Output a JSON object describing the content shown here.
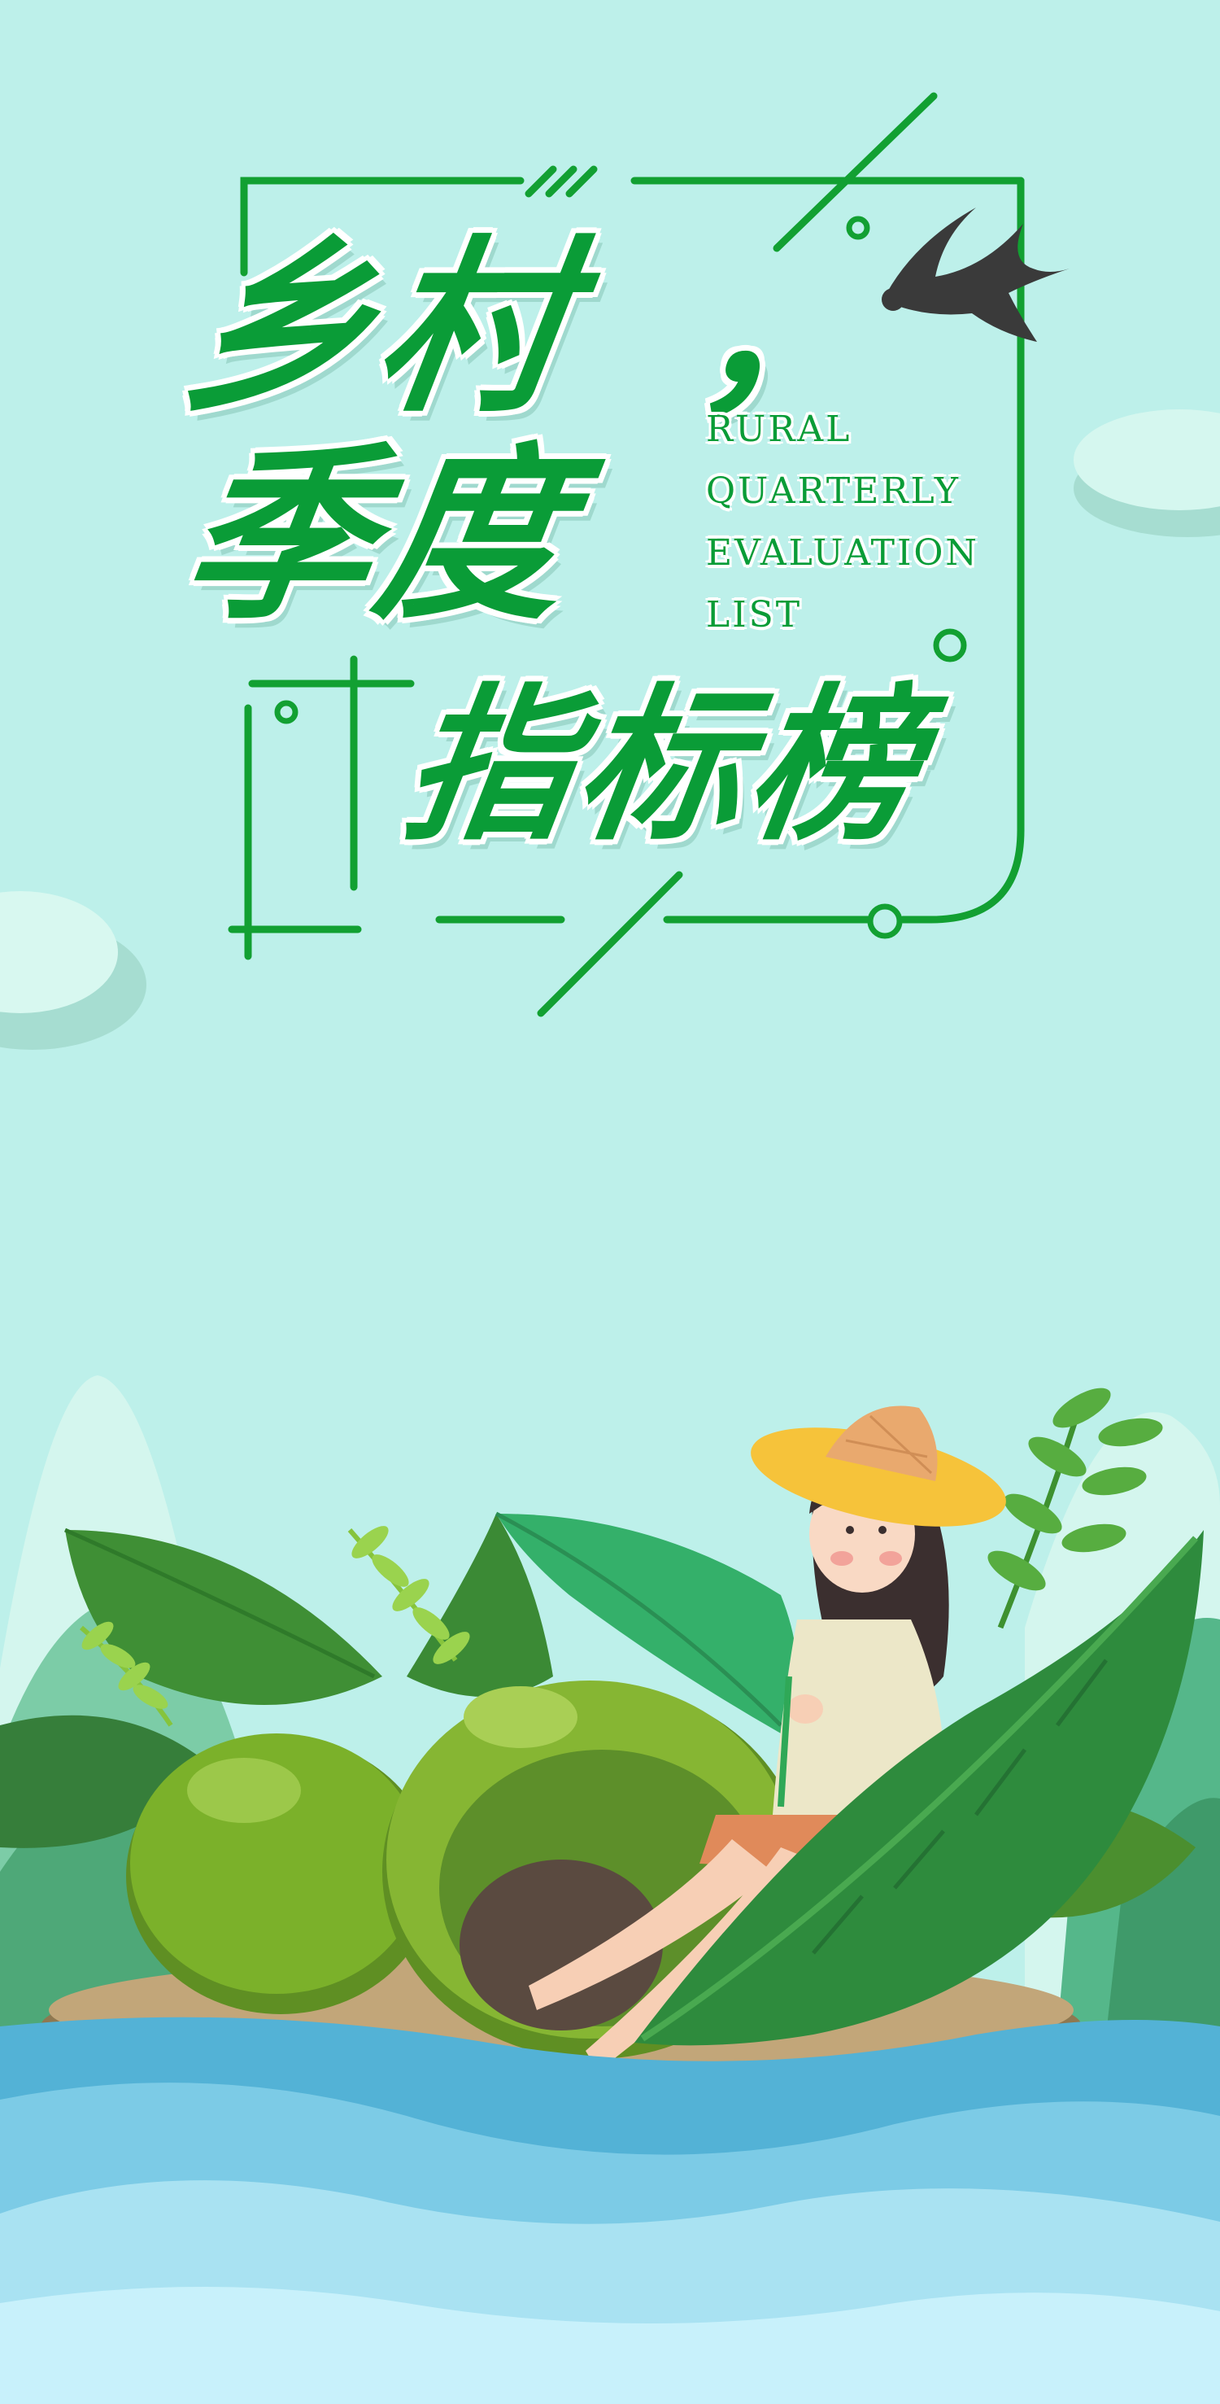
{
  "title": {
    "line1": "乡村",
    "comma": "，",
    "line2": "季度",
    "subtitle": "指标榜"
  },
  "english_title": {
    "lines": [
      "RURAL",
      "QUARTERLY",
      "EVALUATION",
      "LIST"
    ]
  },
  "colors": {
    "background": "#bdf0ea",
    "title_green": "#0a9c37",
    "frame_green": "#12a032",
    "water_blue": "#5bb7d8",
    "avocado_green": "#7bb12a",
    "hat_yellow": "#f6c33a"
  },
  "illustration": {
    "subject": "girl-sitting-on-avocado-island",
    "bird": "swallow"
  }
}
